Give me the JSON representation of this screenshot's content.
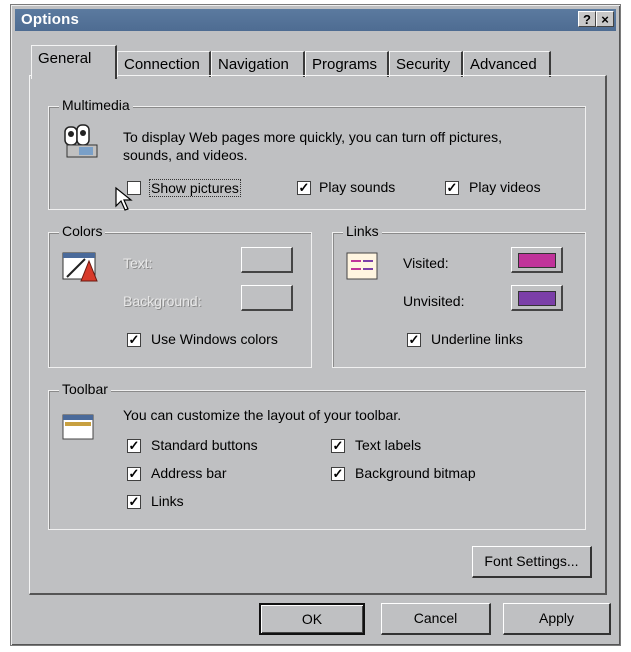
{
  "window": {
    "title": "Options",
    "help_button": "?",
    "close_button": "×"
  },
  "tabs": [
    {
      "label": "General",
      "active": true
    },
    {
      "label": "Connection",
      "active": false
    },
    {
      "label": "Navigation",
      "active": false
    },
    {
      "label": "Programs",
      "active": false
    },
    {
      "label": "Security",
      "active": false
    },
    {
      "label": "Advanced",
      "active": false
    }
  ],
  "multimedia": {
    "group_label": "Multimedia",
    "description_line1": "To display Web pages more quickly, you can turn off pictures,",
    "description_line2": "sounds, and videos.",
    "show_pictures": {
      "label": "Show pictures",
      "checked": false
    },
    "play_sounds": {
      "label": "Play sounds",
      "checked": true
    },
    "play_videos": {
      "label": "Play videos",
      "checked": true
    }
  },
  "colors": {
    "group_label": "Colors",
    "text_label": "Text:",
    "background_label": "Background:",
    "use_windows_colors": {
      "label": "Use Windows colors",
      "checked": true
    }
  },
  "links": {
    "group_label": "Links",
    "visited_label": "Visited:",
    "visited_color": "#c0339a",
    "unvisited_label": "Unvisited:",
    "unvisited_color": "#7b3fa8",
    "underline_links": {
      "label": "Underline links",
      "checked": true
    }
  },
  "toolbar": {
    "group_label": "Toolbar",
    "description": "You can customize the layout of your toolbar.",
    "standard_buttons": {
      "label": "Standard buttons",
      "checked": true
    },
    "text_labels": {
      "label": "Text labels",
      "checked": true
    },
    "address_bar": {
      "label": "Address bar",
      "checked": true
    },
    "background_bitmap": {
      "label": "Background bitmap",
      "checked": true
    },
    "links": {
      "label": "Links",
      "checked": true
    }
  },
  "buttons": {
    "font_settings": "Font Settings...",
    "ok": "OK",
    "cancel": "Cancel",
    "apply": "Apply"
  }
}
